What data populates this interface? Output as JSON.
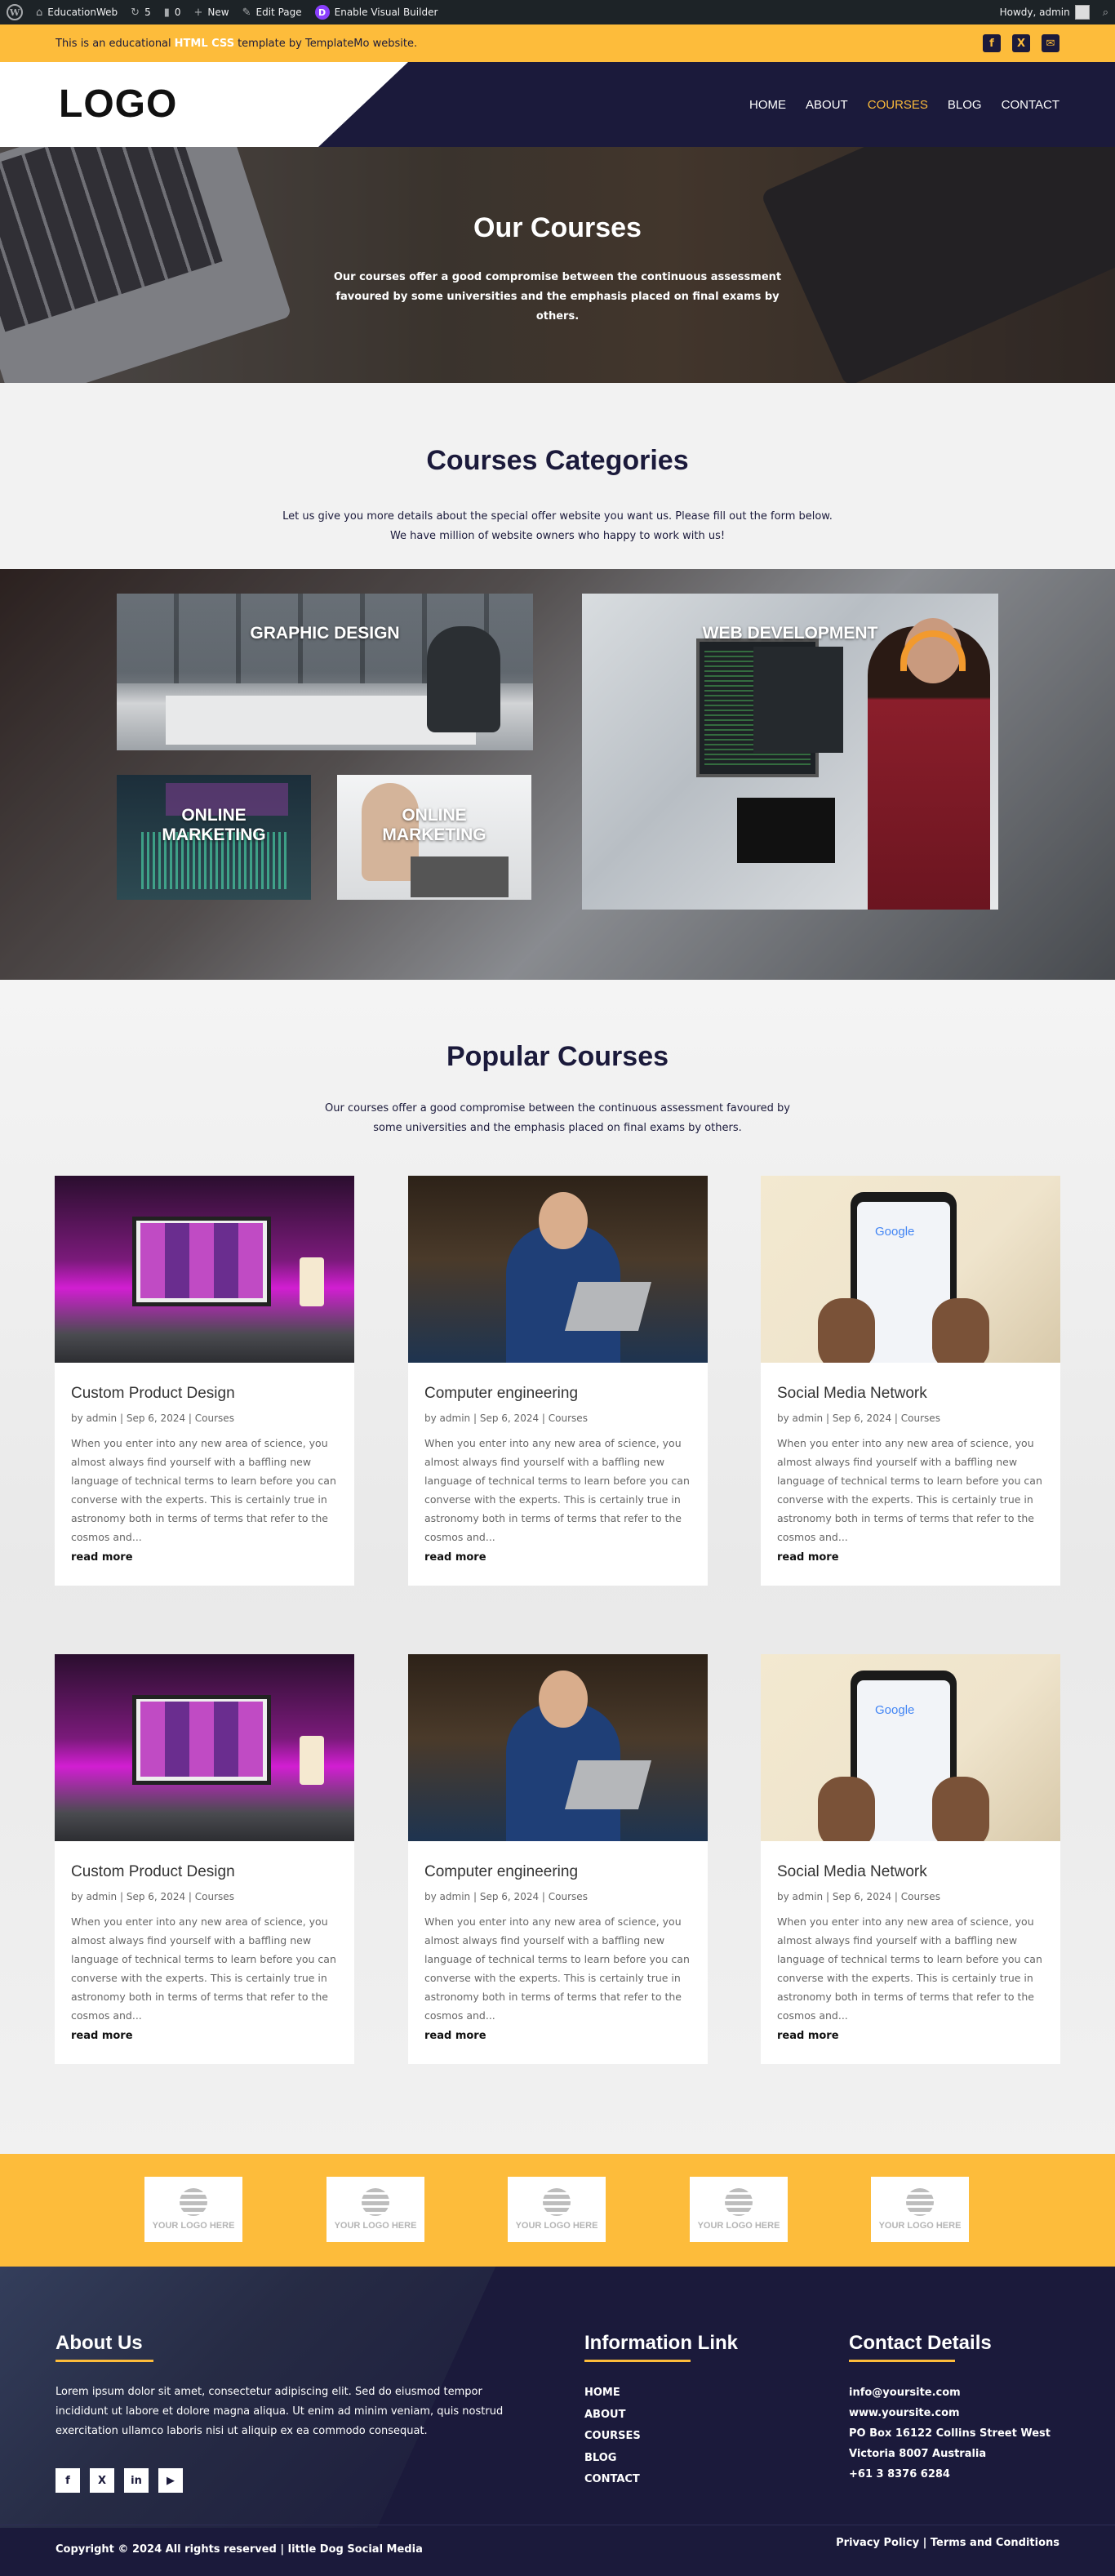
{
  "adminbar": {
    "site_name": "EducationWeb",
    "updates_count": "5",
    "comments_count": "0",
    "new_label": "New",
    "edit_label": "Edit Page",
    "builder_label": "Enable Visual Builder",
    "howdy": "Howdy, admin"
  },
  "topbar": {
    "text_before": "This is an educational",
    "highlight": "HTML CSS",
    "text_after": "template by TemplateMo website.",
    "icons": [
      "facebook-icon",
      "x-icon",
      "email-icon"
    ]
  },
  "header": {
    "logo": "LOGO",
    "nav": [
      "HOME",
      "ABOUT",
      "COURSES",
      "BLOG",
      "CONTACT"
    ],
    "active": "COURSES"
  },
  "hero": {
    "title": "Our Courses",
    "text": "Our courses offer a good compromise between the continuous assessment favoured by some universities and the emphasis placed on final exams by others."
  },
  "categories": {
    "title": "Courses Categories",
    "line1": "Let us give you more details about the special offer website you want us. Please fill out the form below.",
    "line2": "We have million of website owners who happy to work with us!",
    "tiles": {
      "graphic_design": "GRAPHIC DESIGN",
      "web_development": "WEB DEVELOPMENT",
      "online_marketing_1": "ONLINE MARKETING",
      "online_marketing_2": "ONLINE MARKETING"
    }
  },
  "popular": {
    "title": "Popular Courses",
    "intro": "Our courses offer a good compromise between the continuous assessment favoured by some universities and the emphasis placed on final exams by others.",
    "cards": [
      {
        "title": "Custom Product Design",
        "by": "by",
        "author": "admin",
        "date": "Sep 6, 2024",
        "category": "Courses"
      },
      {
        "title": "Computer engineering",
        "by": "by",
        "author": "admin",
        "date": "Sep 6, 2024",
        "category": "Courses"
      },
      {
        "title": "Social Media Network",
        "by": "by",
        "author": "admin",
        "date": "Sep 6, 2024",
        "category": "Courses"
      },
      {
        "title": "Custom Product Design",
        "by": "by",
        "author": "admin",
        "date": "Sep 6, 2024",
        "category": "Courses"
      },
      {
        "title": "Computer engineering",
        "by": "by",
        "author": "admin",
        "date": "Sep 6, 2024",
        "category": "Courses"
      },
      {
        "title": "Social Media Network",
        "by": "by",
        "author": "admin",
        "date": "Sep 6, 2024",
        "category": "Courses"
      }
    ],
    "excerpt": "When you enter into any new area of science, you almost always find yourself with a baffling new language of technical terms to learn before you can converse with the experts. This is certainly true in astronomy both in terms of terms that refer to the cosmos and...",
    "read_more": "read more",
    "sep": "|"
  },
  "partners": {
    "logo_text": "YOUR LOGO HERE",
    "count": 5
  },
  "footer": {
    "about_title": "About Us",
    "about_text": "Lorem ipsum dolor sit amet, consectetur adipiscing elit. Sed do eiusmod tempor incididunt ut labore et dolore magna aliqua. Ut enim ad minim veniam, quis nostrud exercitation ullamco laboris nisi ut aliquip ex ea commodo consequat.",
    "social": [
      "f",
      "X",
      "in",
      "▶"
    ],
    "links_title": "Information Link",
    "links": [
      "HOME",
      "ABOUT",
      "COURSES",
      "BLOG",
      "CONTACT"
    ],
    "contact_title": "Contact Details",
    "email": "info@yoursite.com",
    "website": "www.yoursite.com",
    "address1": "PO Box 16122 Collins Street West",
    "address2": "Victoria 8007 Australia",
    "phone": "+61 3 8376 6284",
    "copyright": "Copyright © 2024 All rights reserved | little Dog Social Media",
    "privacy": "Privacy Policy",
    "terms": "Terms and Conditions",
    "legal_sep": "|"
  },
  "colors": {
    "accent": "#fdbc3b",
    "navy": "#1b1a3b",
    "adminbar": "#1d2327"
  }
}
